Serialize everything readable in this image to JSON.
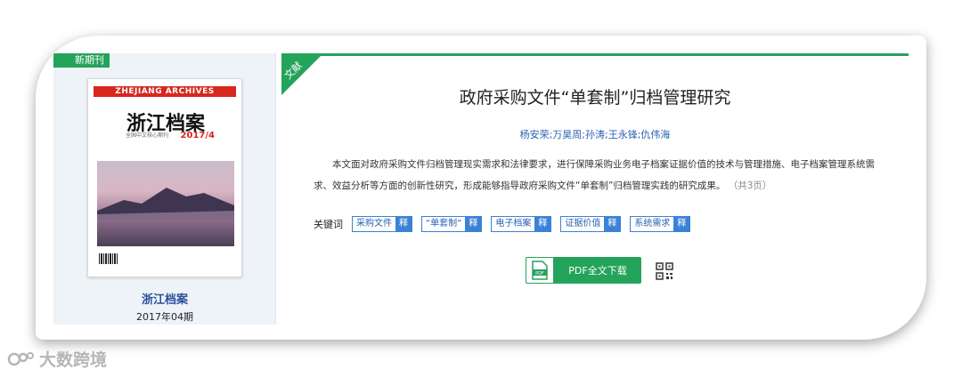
{
  "left": {
    "tag": "新期刊",
    "cover": {
      "band": "ZHEJIANG ARCHIVES",
      "title": "浙江档案",
      "issue": "2017/4",
      "subtitle": "全国中文核心期刊"
    },
    "journal_name": "浙江档案",
    "journal_issue": "2017年04期"
  },
  "article": {
    "ribbon": "文献",
    "title": "政府采购文件“单套制”归档管理研究",
    "authors": "杨安荣;万昊周;孙涛;王永锋;仇伟海",
    "abstract": "本文面对政府采购文件归档管理现实需求和法律要求，进行保障采购业务电子档案证据价值的技术与管理措施、电子档案管理系统需求、效益分析等方面的创新性研究，形成能够指导政府采购文件“单套制”归档管理实践的研究成果。",
    "pages": "（共3页）",
    "keywords_label": "关键词",
    "keywords": [
      {
        "text": "采购文件",
        "btn": "释"
      },
      {
        "text": "“单套制”",
        "btn": "释"
      },
      {
        "text": "电子档案",
        "btn": "释"
      },
      {
        "text": "证据价值",
        "btn": "释"
      },
      {
        "text": "系统需求",
        "btn": "释"
      }
    ],
    "download_label": "PDF全文下载",
    "pdf_icon_text": "PDF"
  },
  "watermark": "大数跨境",
  "colors": {
    "green": "#24a35a",
    "blue": "#3b82d6",
    "link": "#2a62b4"
  }
}
